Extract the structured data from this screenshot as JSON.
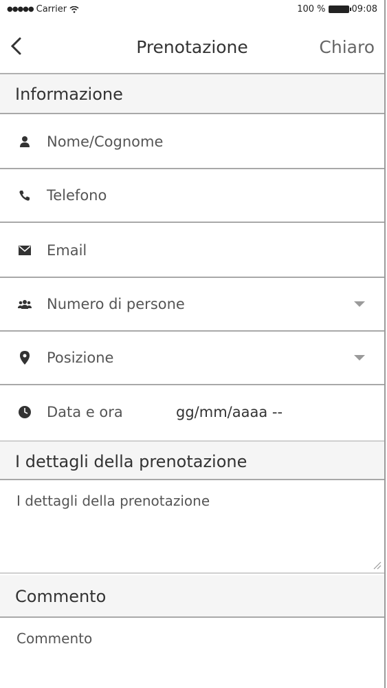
{
  "status_bar": {
    "carrier": "Carrier",
    "battery": "100 %",
    "time": "09:08"
  },
  "navbar": {
    "title": "Prenotazione",
    "action": "Chiaro"
  },
  "sections": {
    "info": "Informazione",
    "details": "I dettagli della prenotazione",
    "comment": "Commento"
  },
  "fields": {
    "name": {
      "placeholder": "Nome/Cognome",
      "icon": "user-icon"
    },
    "phone": {
      "placeholder": "Telefono",
      "icon": "phone-icon"
    },
    "email": {
      "placeholder": "Email",
      "icon": "envelope-icon"
    },
    "people": {
      "placeholder": "Numero di persone",
      "icon": "group-icon"
    },
    "position": {
      "placeholder": "Posizione",
      "icon": "location-pin-icon"
    },
    "datetime": {
      "label": "Data e ora",
      "value": "gg/mm/aaaa --",
      "icon": "clock-icon"
    }
  },
  "details_textarea": {
    "placeholder": "I dettagli della prenotazione"
  },
  "comment_textarea": {
    "placeholder": "Commento"
  }
}
